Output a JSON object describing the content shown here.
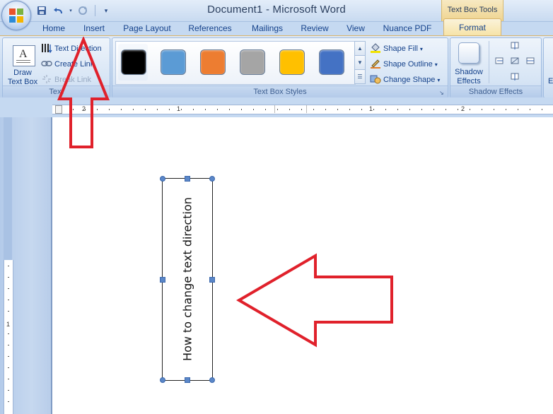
{
  "window": {
    "title": "Document1 - Microsoft Word",
    "contextual_tab_group": "Text Box Tools"
  },
  "quick_access": {
    "save": "save-icon",
    "undo": "undo-icon",
    "redo": "redo-icon",
    "customize": "customize-icon"
  },
  "tabs": [
    {
      "label": "Home"
    },
    {
      "label": "Insert"
    },
    {
      "label": "Page Layout"
    },
    {
      "label": "References"
    },
    {
      "label": "Mailings"
    },
    {
      "label": "Review"
    },
    {
      "label": "View"
    },
    {
      "label": "Nuance PDF"
    },
    {
      "label": "Format",
      "active": true
    }
  ],
  "ribbon": {
    "text_group": {
      "label": "Text",
      "draw_text_box_line1": "Draw",
      "draw_text_box_line2": "Text Box",
      "text_direction": "Text Direction",
      "create_link": "Create Link",
      "break_link": "Break Link"
    },
    "styles_group": {
      "label": "Text Box Styles",
      "swatches": [
        "#000000",
        "#5b9bd5",
        "#ed7d31",
        "#a5a5a5",
        "#ffc000",
        "#4472c4"
      ],
      "shape_fill": "Shape Fill",
      "shape_outline": "Shape Outline",
      "change_shape": "Change Shape"
    },
    "shadow_group": {
      "label": "Shadow Effects",
      "shadow_effects_line1": "Shadow",
      "shadow_effects_line2": "Effects"
    },
    "next_group_partial": "Et"
  },
  "ruler": {
    "labels": [
      "2",
      "1",
      "1",
      "2"
    ]
  },
  "vertical_ruler": {
    "label": "1"
  },
  "document": {
    "textbox_text": "How to change text direction"
  },
  "annotations": {
    "arrow_color": "#e0212b"
  }
}
